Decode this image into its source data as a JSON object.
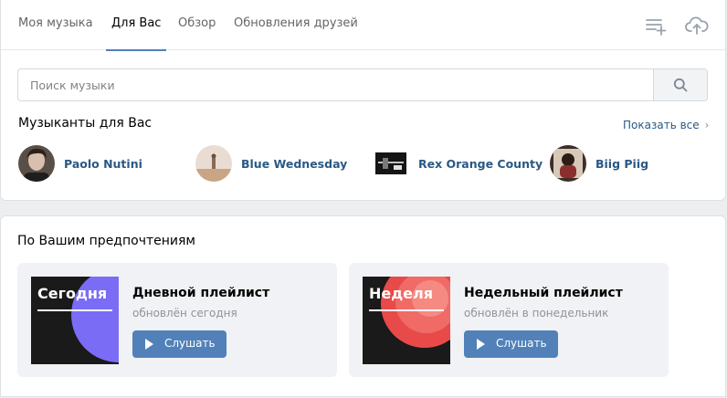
{
  "tabs": [
    {
      "label": "Моя музыка",
      "active": false
    },
    {
      "label": "Для Вас",
      "active": true
    },
    {
      "label": "Обзор",
      "active": false
    },
    {
      "label": "Обновления друзей",
      "active": false
    }
  ],
  "header_icons": [
    "add-playlist-icon",
    "upload-icon"
  ],
  "search": {
    "placeholder": "Поиск музыки",
    "value": "",
    "icon": "search-icon"
  },
  "artists_section": {
    "title": "Музыканты для Вас",
    "show_all": "Показать все",
    "artists": [
      {
        "name": "Paolo Nutini"
      },
      {
        "name": "Blue Wednesday"
      },
      {
        "name": "Rex Orange County"
      },
      {
        "name": "Biig Piig"
      }
    ]
  },
  "prefs_section": {
    "title": "По Вашим предпочтениям",
    "playlists": [
      {
        "cover_label": "Сегодня",
        "title": "Дневной плейлист",
        "subtitle": "обновлён сегодня",
        "button": "Слушать",
        "accent": "#7b6cf6"
      },
      {
        "cover_label": "Неделя",
        "title": "Недельный плейлист",
        "subtitle": "обновлён в понедельник",
        "button": "Слушать",
        "accent": "#ff5c5c"
      }
    ]
  },
  "colors": {
    "accent": "#5181b8",
    "link": "#2a5885",
    "background": "#edeef0"
  }
}
